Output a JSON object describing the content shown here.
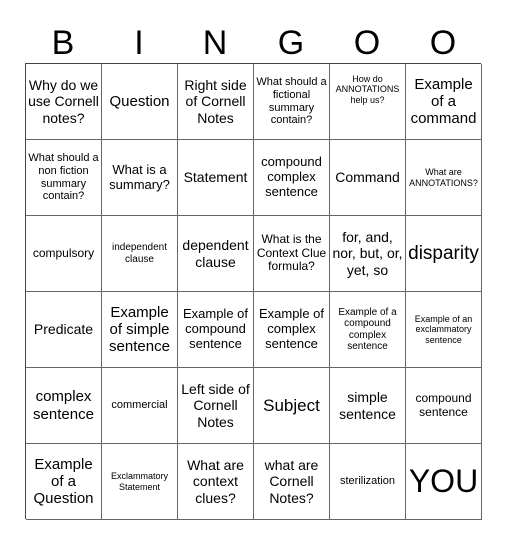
{
  "header": [
    "B",
    "I",
    "N",
    "G",
    "O",
    "O"
  ],
  "cells": [
    [
      "Why do we use Cornell notes?",
      "Question",
      "Right side of Cornell Notes",
      "What should a fictional summary contain?",
      "How do ANNOTATIONS help us?",
      "Example of a command"
    ],
    [
      "What should a non fiction summary contain?",
      "What is a summary?",
      "Statement",
      "compound complex sentence",
      "Command",
      "What are ANNOTATIONS?"
    ],
    [
      "compulsory",
      "independent clause",
      "dependent clause",
      "What is the Context Clue formula?",
      "for, and, nor, but, or, yet, so",
      "disparity"
    ],
    [
      "Predicate",
      "Example of simple sentence",
      "Example of compound sentence",
      "Example of complex sentence",
      "Example of a compound complex sentence",
      "Example of an exclammatory sentence"
    ],
    [
      "complex sentence",
      "commercial",
      "Left side of Cornell Notes",
      "Subject",
      "simple sentence",
      "compound sentence"
    ],
    [
      "Example of a Question",
      "Exclammatory Statement",
      "What are context clues?",
      "what are Cornell Notes?",
      "sterilization",
      "YOU"
    ]
  ]
}
